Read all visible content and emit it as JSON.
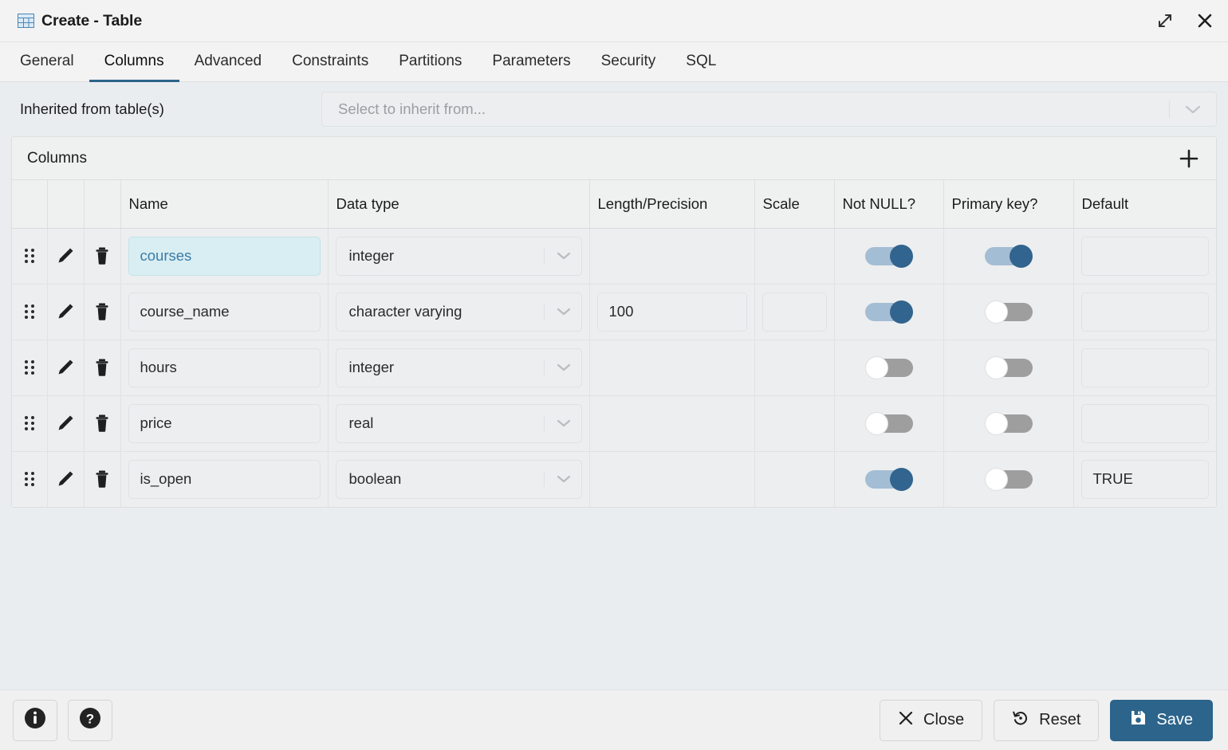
{
  "window": {
    "title": "Create - Table",
    "icon": "table-icon",
    "maximize_icon": "maximize-icon",
    "close_icon": "close-icon"
  },
  "tabs": [
    {
      "label": "General",
      "active": false
    },
    {
      "label": "Columns",
      "active": true
    },
    {
      "label": "Advanced",
      "active": false
    },
    {
      "label": "Constraints",
      "active": false
    },
    {
      "label": "Partitions",
      "active": false
    },
    {
      "label": "Parameters",
      "active": false
    },
    {
      "label": "Security",
      "active": false
    },
    {
      "label": "SQL",
      "active": false
    }
  ],
  "inherit": {
    "label": "Inherited from table(s)",
    "placeholder": "Select to inherit from...",
    "value": "",
    "chevron_icon": "chevron-down-icon"
  },
  "columns_panel": {
    "title": "Columns",
    "add_icon": "plus-icon",
    "headers": [
      "",
      "",
      "",
      "Name",
      "Data type",
      "Length/Precision",
      "Scale",
      "Not NULL?",
      "Primary key?",
      "Default"
    ],
    "rows": [
      {
        "handle_icon": "drag-handle-icon",
        "edit_icon": "pencil-icon",
        "delete_icon": "trash-icon",
        "name": "courses",
        "name_focused": true,
        "data_type": "integer",
        "length": "",
        "has_length_field": false,
        "scale": "",
        "has_scale_field": false,
        "not_null": true,
        "primary_key": true,
        "default": ""
      },
      {
        "handle_icon": "drag-handle-icon",
        "edit_icon": "pencil-icon",
        "delete_icon": "trash-icon",
        "name": "course_name",
        "name_focused": false,
        "data_type": "character varying",
        "length": "100",
        "has_length_field": true,
        "scale": "",
        "has_scale_field": true,
        "not_null": true,
        "primary_key": false,
        "default": ""
      },
      {
        "handle_icon": "drag-handle-icon",
        "edit_icon": "pencil-icon",
        "delete_icon": "trash-icon",
        "name": "hours",
        "name_focused": false,
        "data_type": "integer",
        "length": "",
        "has_length_field": false,
        "scale": "",
        "has_scale_field": false,
        "not_null": false,
        "primary_key": false,
        "default": ""
      },
      {
        "handle_icon": "drag-handle-icon",
        "edit_icon": "pencil-icon",
        "delete_icon": "trash-icon",
        "name": "price",
        "name_focused": false,
        "data_type": "real",
        "length": "",
        "has_length_field": false,
        "scale": "",
        "has_scale_field": false,
        "not_null": false,
        "primary_key": false,
        "default": ""
      },
      {
        "handle_icon": "drag-handle-icon",
        "edit_icon": "pencil-icon",
        "delete_icon": "trash-icon",
        "name": "is_open",
        "name_focused": false,
        "data_type": "boolean",
        "length": "",
        "has_length_field": false,
        "scale": "",
        "has_scale_field": false,
        "not_null": true,
        "primary_key": false,
        "default": "TRUE"
      }
    ]
  },
  "footer": {
    "info_icon": "info-icon",
    "help_icon": "help-icon",
    "close_label": "Close",
    "close_icon": "close-x-icon",
    "reset_label": "Reset",
    "reset_icon": "reset-icon",
    "save_label": "Save",
    "save_icon": "save-disk-icon"
  },
  "colors": {
    "accent": "#2c648b",
    "toggle_on_track": "#a3bdd4",
    "toggle_on_knob": "#31648e",
    "toggle_off_track": "#9e9e9e",
    "focused_field_bg": "#d9eef2",
    "focused_field_text": "#3a7ca8",
    "body_bg": "#e9edef"
  }
}
